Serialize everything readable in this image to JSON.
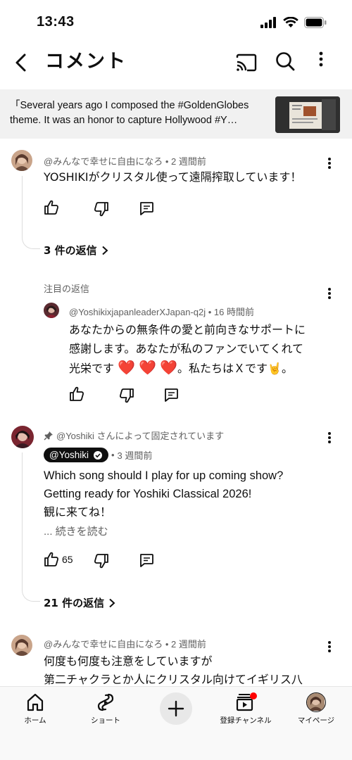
{
  "status_bar": {
    "time": "13:43"
  },
  "header": {
    "title": "コメント"
  },
  "video_banner": {
    "text": "「Several years ago I composed the #GoldenGlobes theme. It was an honor to capture Hollywood #Y…"
  },
  "comments": [
    {
      "author": "@みんなで幸せに自由になろ",
      "time": "2 週間前",
      "text": "YOSHIKIがクリスタル使って遠隔搾取しています！",
      "replies_label": "3 件の返信"
    },
    {
      "highlight_label": "注目の返信",
      "reply_author": "@YoshikixjapanleaderXJapan-q2j",
      "reply_time": "16 時間前",
      "reply_line1": "あなたからの無条件の愛と前向きなサポートに",
      "reply_line2": "感謝します。あなたが私のファンでいてくれて",
      "reply_line3_a": "光栄です",
      "reply_line3_b": "。私たちはＸです",
      "reply_line3_c": "。",
      "hearts": "❤️",
      "horns": "🤘"
    },
    {
      "pinned_label": "@Yoshiki さんによって固定されています",
      "author": "@Yoshiki",
      "time": "3 週間前",
      "line1": "Which song should I play for up coming show?",
      "line2": "Getting ready for Yoshiki Classical 2026!",
      "line3": "観に来てね！",
      "read_more": "... 続きを読む",
      "likes": "65",
      "replies_label": "21 件の返信"
    },
    {
      "author": "@みんなで幸せに自由になろ",
      "time": "2 週間前",
      "line1": "何度も何度も注意をしていますが",
      "line2": "第二チャクラとか人にクリスタル向けてイギリス八"
    }
  ],
  "bottom_nav": {
    "home": "ホーム",
    "shorts": "ショート",
    "subscriptions": "登録チャンネル",
    "you": "マイページ"
  },
  "colors": {
    "notification_dot": "#ff0000",
    "heart": "#e0142b"
  }
}
